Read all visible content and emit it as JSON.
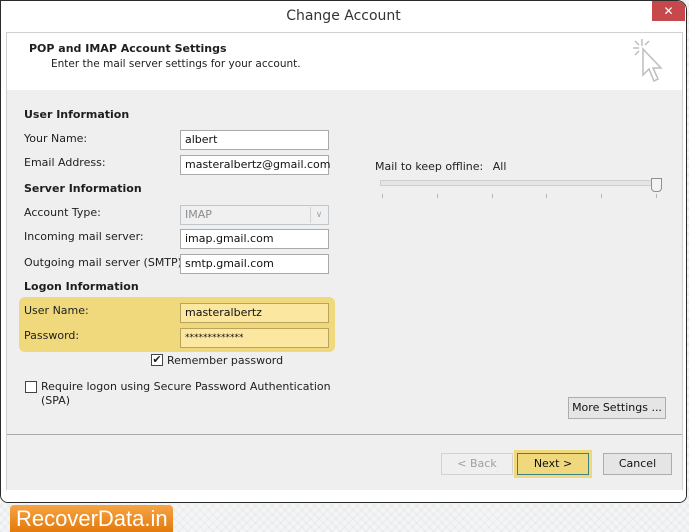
{
  "window": {
    "title": "Change Account",
    "close_label": "✕"
  },
  "header": {
    "title": "POP and IMAP Account Settings",
    "subtitle": "Enter the mail server settings for your account.",
    "icon": "cursor-click-icon"
  },
  "user_info": {
    "section_label": "User Information",
    "your_name_label": "Your Name:",
    "your_name_value": "albert",
    "email_label": "Email Address:",
    "email_value": "masteralbertz@gmail.com"
  },
  "server_info": {
    "section_label": "Server Information",
    "account_type_label": "Account Type:",
    "account_type_value": "IMAP",
    "incoming_label": "Incoming mail server:",
    "incoming_value": "imap.gmail.com",
    "outgoing_label": "Outgoing mail server (SMTP):",
    "outgoing_value": "smtp.gmail.com"
  },
  "logon_info": {
    "section_label": "Logon Information",
    "username_label": "User Name:",
    "username_value": "masteralbertz",
    "password_label": "Password:",
    "password_value": "*************",
    "remember_password_label": "Remember password",
    "remember_password_checked": true,
    "spa_label_line1": "Require logon using Secure Password Authentication",
    "spa_label_line2": "(SPA)",
    "spa_checked": false
  },
  "offline": {
    "label": "Mail to keep offline:",
    "value": "All",
    "slider_position_fraction": 1.0,
    "tick_count": 6
  },
  "buttons": {
    "more_settings": "More Settings ...",
    "back": "< Back",
    "next": "Next >",
    "cancel": "Cancel"
  },
  "watermark": {
    "text": "RecoverData.in",
    "color": "#e9861f"
  }
}
